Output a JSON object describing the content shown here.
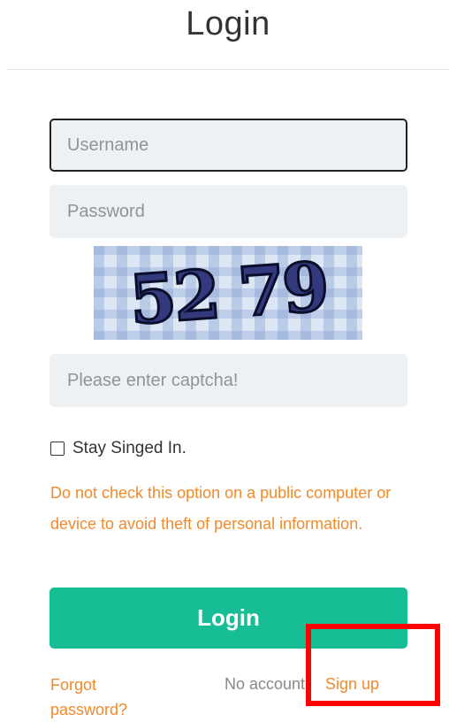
{
  "header": {
    "title": "Login"
  },
  "form": {
    "username_placeholder": "Username",
    "password_placeholder": "Password",
    "captcha_text": "52 79",
    "captcha_placeholder": "Please enter captcha!",
    "remember_label": "Stay Singed In.",
    "warning": "Do not check this option on a public computer or device to avoid theft of personal information.",
    "login_label": "Login"
  },
  "footer": {
    "forgot_label": "Forgot password?",
    "no_account_label": "No account",
    "signup_label": "Sign up"
  },
  "colors": {
    "accent": "#17bd95",
    "link": "#f08a2b",
    "annotation": "#ff0000"
  }
}
